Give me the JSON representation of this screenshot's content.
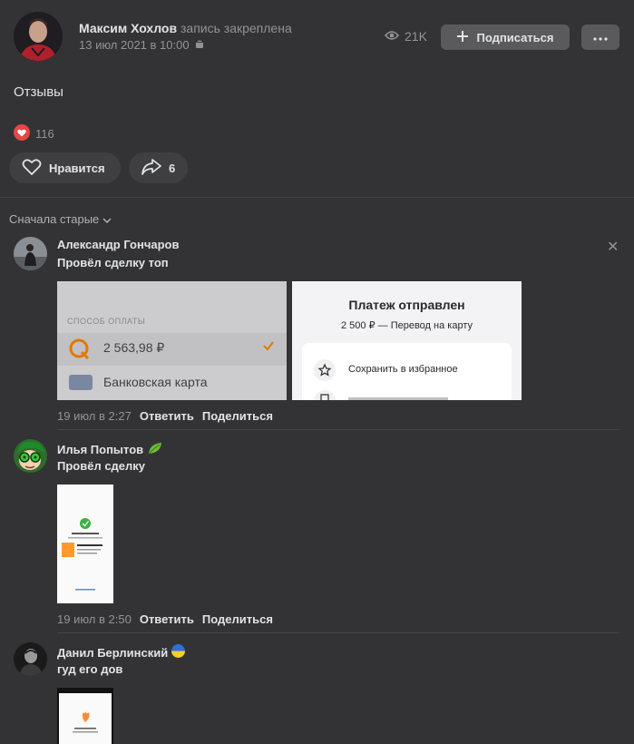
{
  "post": {
    "author": "Максим Хохлов",
    "pinned_label": "запись закреплена",
    "date": "13 июл 2021 в 10:00",
    "views": "21K",
    "subscribe_label": "Подписаться",
    "text": "Отзывы",
    "reaction_count": "116",
    "like_label": "Нравится",
    "share_count": "6"
  },
  "comments_header": {
    "sort_label": "Сначала старые"
  },
  "comments": [
    {
      "author": "Александр Гончаров",
      "text": "Провёл сделку топ",
      "date": "19 июл в 2:27",
      "reply": "Ответить",
      "share": "Поделиться",
      "attachment1": {
        "section": "СПОСОБ ОПЛАТЫ",
        "amount": "2 563,98 ₽",
        "card": "Банковская карта"
      },
      "attachment2": {
        "title": "Платеж отправлен",
        "subtitle": "2 500 ₽ — Перевод на карту",
        "action": "Сохранить в избранное"
      }
    },
    {
      "author": "Илья Попытов",
      "text": "Провёл сделку",
      "date": "19 июл в 2:50",
      "reply": "Ответить",
      "share": "Поделиться"
    },
    {
      "author": "Данил Берлинский",
      "text": "гуд его дов"
    }
  ],
  "colors": {
    "background": "#333336",
    "button": "#5a5a5d",
    "reaction_red": "#e64646",
    "accent_orange": "#ff8a00"
  }
}
